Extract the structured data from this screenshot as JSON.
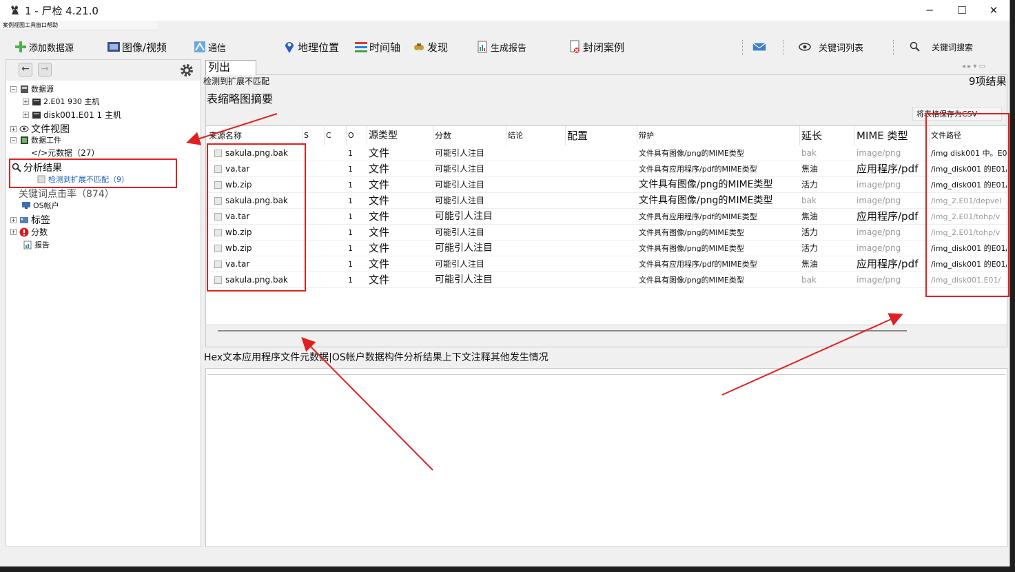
{
  "window": {
    "title": "1 - 尸检 4.21.0",
    "menu": "案例视图工具窗口帮助"
  },
  "toolbar": {
    "add_source": "添加数据源",
    "images_video": "图像/视频",
    "comms": "通信",
    "geo": "地理位置",
    "timeline": "时间轴",
    "discovery": "发现",
    "report": "生成报告",
    "close_case": "封闭案例",
    "keyword_list": "关键词列表",
    "keyword_search": "关键词搜索"
  },
  "tree": {
    "data_sources": "数据源",
    "host1": "2.E01 930 主机",
    "host2": "disk001.E01 1 主机",
    "file_view": "文件视图",
    "data_artifacts": "数据工件",
    "metadata": "</>元数据（27）",
    "analysis_results": "分析结果",
    "ext_mismatch": "检测到扩展不匹配（9）",
    "keyword_hits": "关键词点击率（874）",
    "os_accounts": "OS帐户",
    "tags": "标签",
    "score": "分数",
    "reports": "报告"
  },
  "listing": {
    "tab": "列出",
    "subtitle": "检测到扩展不匹配",
    "tabs_label": "表缩略图摘要",
    "results": "9项结果",
    "save_csv": "将表格保存为CSV",
    "columns": [
      "来源名称",
      "S",
      "C",
      "O",
      "源类型",
      "分数",
      "结论",
      "配置",
      "辩护",
      "延长",
      "MIME 类型",
      "文件路径"
    ],
    "rows": [
      {
        "name": "sakula.png.bak",
        "o": "1",
        "type": "文件",
        "score": "可能引人注目",
        "just": "文件具有图像/png的MIME类型",
        "ext": "bak",
        "mime": "image/png",
        "path": "/img disk001 中。E01/"
      },
      {
        "name": "va.tar",
        "o": "1",
        "type": "文件",
        "score": "可能引人注目",
        "just": "文件具有应用程序/pdf的MIME类型",
        "ext": "焦油",
        "mime": "应用程序/pdf",
        "path": "/img_disk001 的E01/"
      },
      {
        "name": "wb.zip",
        "o": "1",
        "type": "文件",
        "score": "可能引人注目",
        "just": "文件具有图像/png的MIME类型",
        "ext": "活力",
        "mime": "image/png",
        "path": "/img_disk001 的E01/"
      },
      {
        "name": "sakula.png.bak",
        "o": "1",
        "type": "文件",
        "score": "可能引人注目",
        "just": "文件具有图像/png的MIME类型",
        "ext": "bak",
        "mime": "image/png",
        "path": "/img_2.E01/depvel"
      },
      {
        "name": "va.tar",
        "o": "1",
        "type": "文件",
        "score": "可能引人注目",
        "just": "文件具有应用程序/pdf的MIME类型",
        "ext": "焦油",
        "mime": "应用程序/pdf",
        "path": "/img_2.E01/tohp/v"
      },
      {
        "name": "wb.zip",
        "o": "1",
        "type": "文件",
        "score": "可能引人注目",
        "just": "文件具有图像/png的MIME类型",
        "ext": "活力",
        "mime": "image/png",
        "path": "/img_2.E01/tohp/v"
      },
      {
        "name": "wb.zip",
        "o": "1",
        "type": "文件",
        "score": "可能引人注目",
        "just": "文件具有图像/png的MIME类型",
        "ext": "活力",
        "mime": "image/png",
        "path": "/img_disk001 的E01/"
      },
      {
        "name": "va.tar",
        "o": "1",
        "type": "文件",
        "score": "可能引人注目",
        "just": "文件具有应用程序/pdf的MIME类型",
        "ext": "焦油",
        "mime": "应用程序/pdf",
        "path": "/img_disk001 的E01/"
      },
      {
        "name": "sakula.png.bak",
        "o": "1",
        "type": "文件",
        "score": "可能引人注目",
        "just": "文件具有图像/png的MIME类型",
        "ext": "bak",
        "mime": "image/png",
        "path": "/img_disk001.E01/"
      }
    ]
  },
  "content": {
    "tabs": "Hex文本应用程序文件元数据|OS帐户数据构件分析结果上下文注释其他发生情况"
  },
  "colors": {
    "annotation_red": "#e02020",
    "selected_blue": "#1d5fb4"
  }
}
